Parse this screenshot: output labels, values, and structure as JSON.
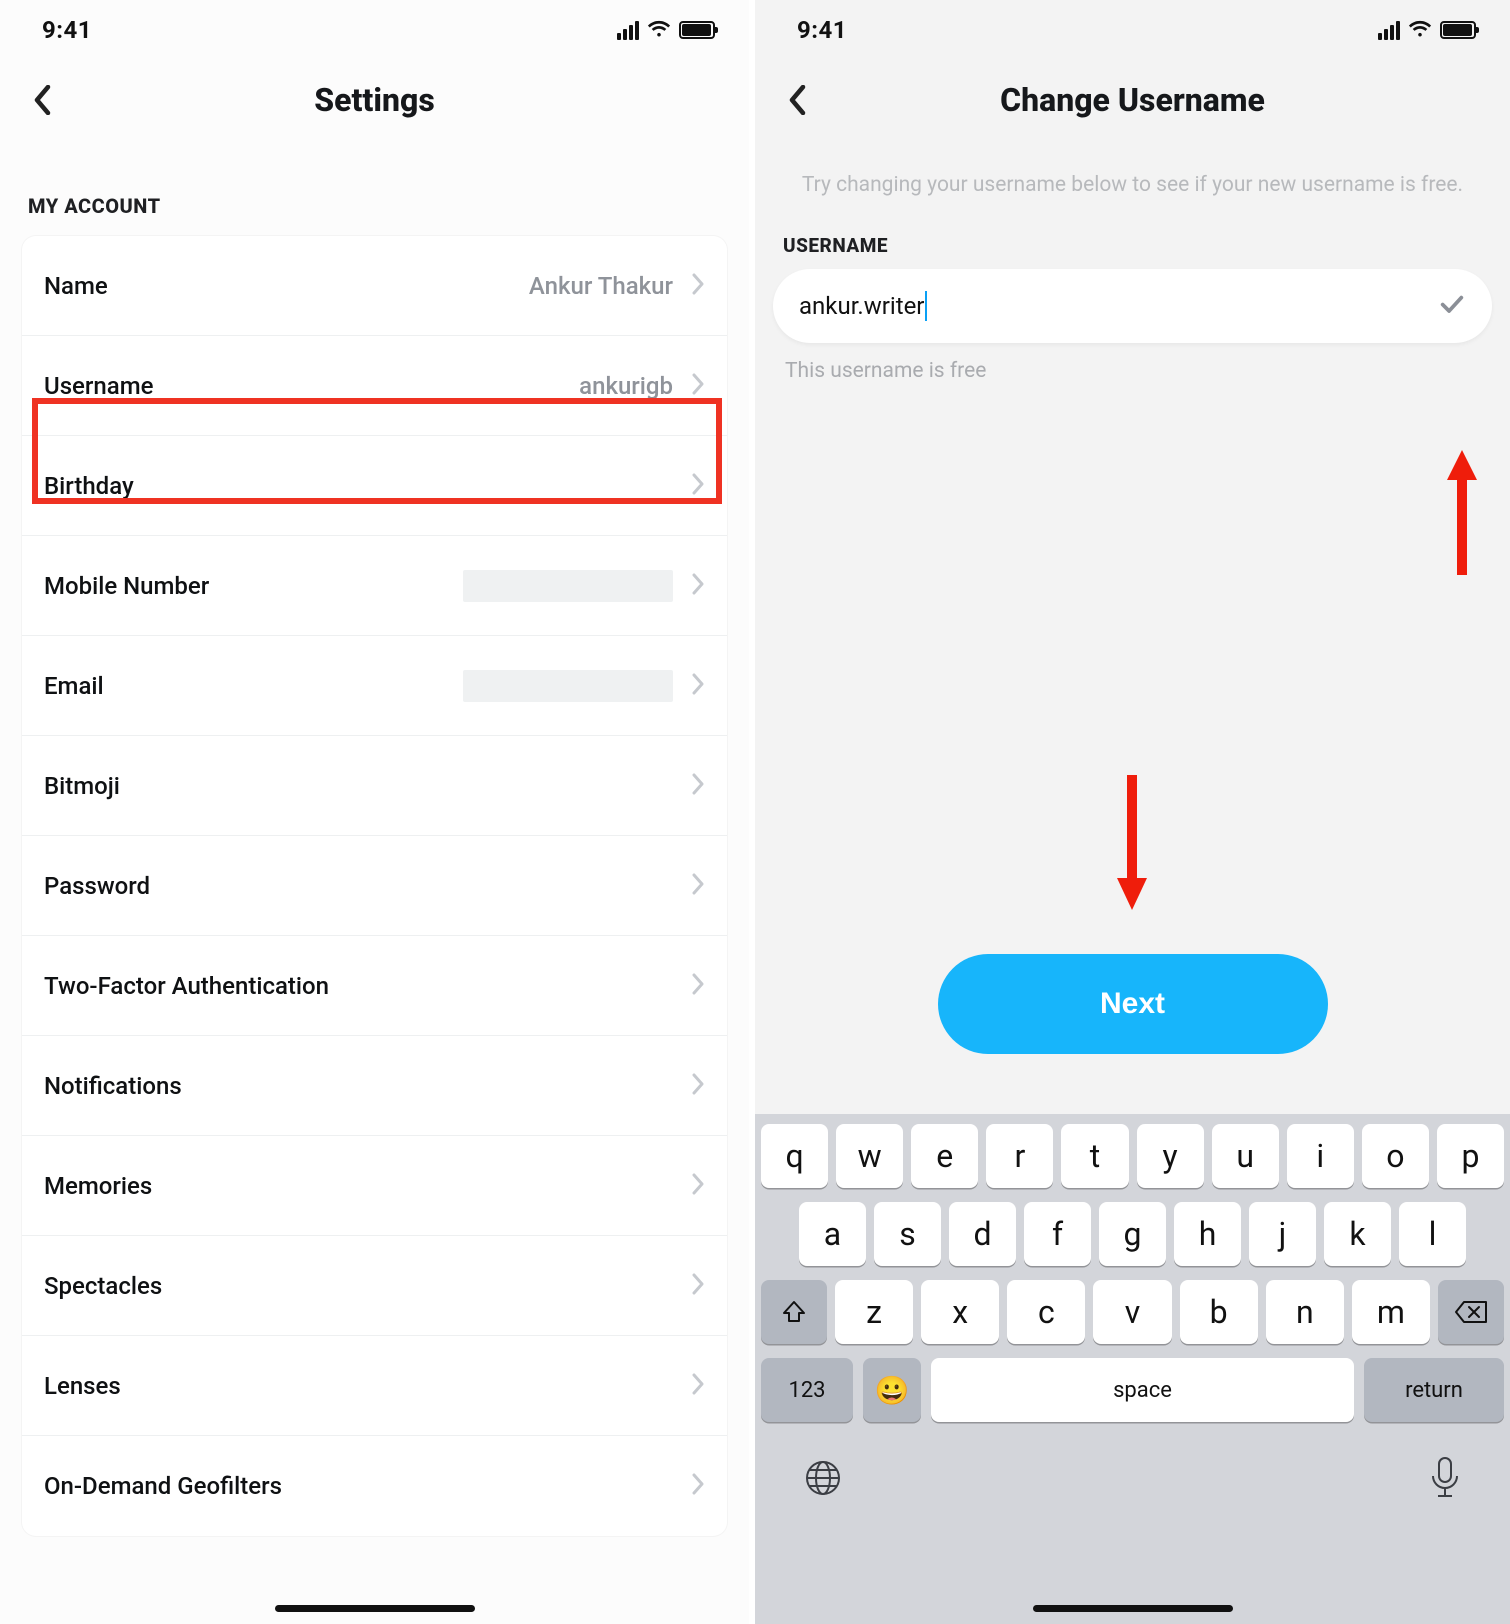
{
  "left": {
    "status": {
      "time": "9:41"
    },
    "title": "Settings",
    "sectionHeader": "MY ACCOUNT",
    "rows": [
      {
        "label": "Name",
        "value": "Ankur Thakur",
        "redacted": false
      },
      {
        "label": "Username",
        "value": "ankurigb",
        "redacted": false
      },
      {
        "label": "Birthday",
        "value": "",
        "redacted": false
      },
      {
        "label": "Mobile Number",
        "value": "",
        "redacted": true
      },
      {
        "label": "Email",
        "value": "",
        "redacted": true
      },
      {
        "label": "Bitmoji",
        "value": "",
        "redacted": false
      },
      {
        "label": "Password",
        "value": "",
        "redacted": false
      },
      {
        "label": "Two-Factor Authentication",
        "value": "",
        "redacted": false
      },
      {
        "label": "Notifications",
        "value": "",
        "redacted": false
      },
      {
        "label": "Memories",
        "value": "",
        "redacted": false
      },
      {
        "label": "Spectacles",
        "value": "",
        "redacted": false
      },
      {
        "label": "Lenses",
        "value": "",
        "redacted": false
      },
      {
        "label": "On-Demand Geofilters",
        "value": "",
        "redacted": false
      }
    ]
  },
  "right": {
    "status": {
      "time": "9:41"
    },
    "title": "Change Username",
    "helper": "Try changing your username below to see if your new username is free.",
    "fieldLabel": "USERNAME",
    "inputValue": "ankur.writer",
    "hint": "This username is free",
    "nextLabel": "Next",
    "keyboard": {
      "row1": [
        "q",
        "w",
        "e",
        "r",
        "t",
        "y",
        "u",
        "i",
        "o",
        "p"
      ],
      "row2": [
        "a",
        "s",
        "d",
        "f",
        "g",
        "h",
        "j",
        "k",
        "l"
      ],
      "row3": [
        "z",
        "x",
        "c",
        "v",
        "b",
        "n",
        "m"
      ],
      "numLabel": "123",
      "emoji": "😀",
      "spaceLabel": "space",
      "returnLabel": "return"
    }
  }
}
